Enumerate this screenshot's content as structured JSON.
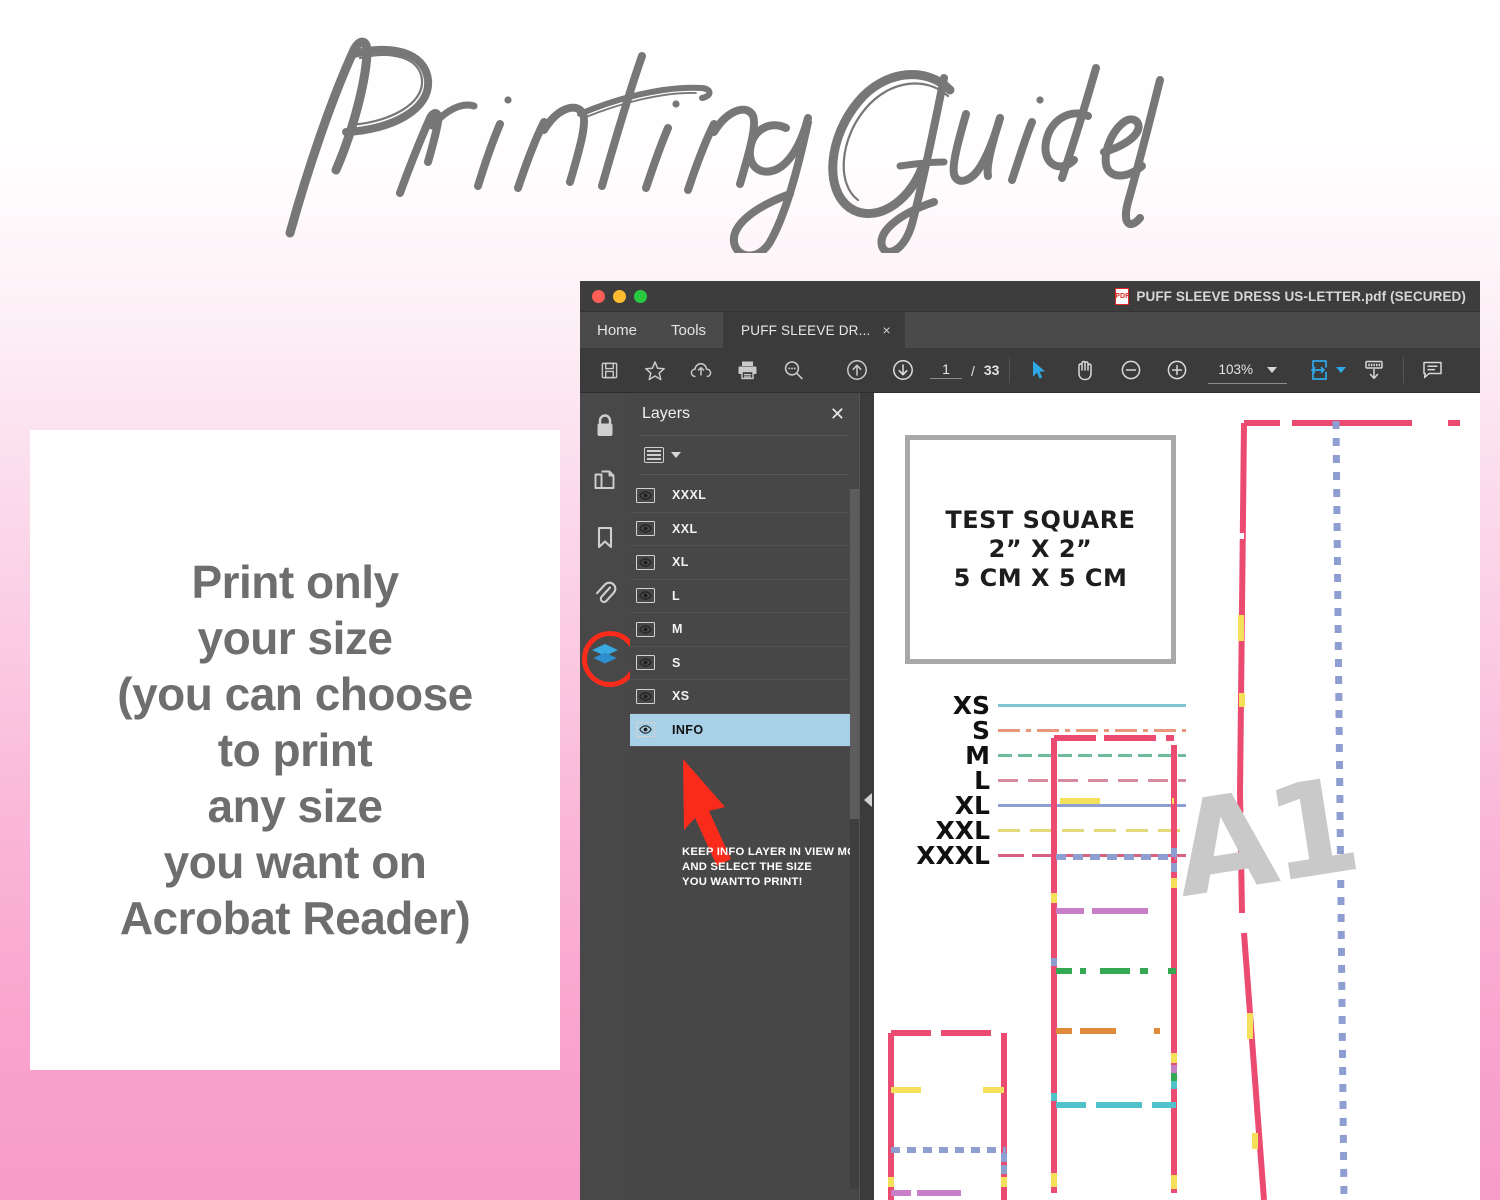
{
  "header": {
    "title": "Printing Guide"
  },
  "info_card": {
    "lines": [
      "Print only",
      "your size",
      "(you can choose",
      "to print",
      "any size",
      "you want on",
      "Acrobat Reader)"
    ]
  },
  "window": {
    "titlebar": {
      "document_title": "PUFF SLEEVE DRESS US-LETTER.pdf (SECURED)",
      "pdf_icon": "pdf-file-icon",
      "traffic_lights": [
        "close-red",
        "minimize-yellow",
        "maximize-green"
      ]
    },
    "tabs": {
      "menu": [
        "Home",
        "Tools"
      ],
      "document_tab": "PUFF SLEEVE DR...",
      "close_label": "×"
    },
    "toolbar": {
      "icons_left": [
        "save-icon",
        "star-icon",
        "upload-cloud-icon",
        "print-icon",
        "search-zoom-icon"
      ],
      "page_nav": [
        "previous-page-icon",
        "next-page-icon"
      ],
      "page_current": "1",
      "page_separator": "/",
      "page_total": "33",
      "tools": [
        "select-cursor-icon",
        "hand-tool-icon",
        "zoom-out-icon",
        "zoom-in-icon"
      ],
      "zoom_level": "103%",
      "icons_right": [
        "fit-page-icon",
        "fit-width-icon",
        "comment-icon"
      ]
    },
    "navrail": [
      {
        "name": "security-lock-icon"
      },
      {
        "name": "page-thumbnails-icon"
      },
      {
        "name": "bookmarks-icon"
      },
      {
        "name": "attachments-icon"
      },
      {
        "name": "layers-icon",
        "selected": true,
        "highlight_color": "#fb2b1c"
      }
    ],
    "layers_panel": {
      "title": "Layers",
      "close_label": "✕",
      "options_icon": "list-options-icon",
      "layers": [
        {
          "label": "XXXL",
          "selected": false
        },
        {
          "label": "XXL",
          "selected": false
        },
        {
          "label": "XL",
          "selected": false
        },
        {
          "label": "L",
          "selected": false
        },
        {
          "label": "M",
          "selected": false
        },
        {
          "label": "S",
          "selected": false
        },
        {
          "label": "XS",
          "selected": false
        },
        {
          "label": "INFO",
          "selected": true
        }
      ],
      "selected_color": "#a8d0e6",
      "annotation": "KEEP INFO LAYER IN VIEW MODE\nAND SELECT THE SIZE\nYOU WANTTO PRINT!",
      "annotation_lines": [
        "KEEP INFO LAYER IN VIEW MODE",
        "AND SELECT THE SIZE",
        "YOU WANTTO PRINT!"
      ],
      "arrow_color": "#fb2b1c"
    },
    "page_content": {
      "test_square": {
        "lines": [
          "TEST SQUARE",
          "2” X 2”",
          "5 CM X 5 CM"
        ],
        "border_color": "#a8a8a8"
      },
      "size_legend": [
        {
          "label": "XS",
          "color": "#7fc4d0",
          "style": "solid"
        },
        {
          "label": "S",
          "color": "#e8977a",
          "style": "dashdot"
        },
        {
          "label": "M",
          "color": "#6fba9a",
          "style": "dashed"
        },
        {
          "label": "L",
          "color": "#d78a9e",
          "style": "dashed"
        },
        {
          "label": "XL",
          "color": "#8e9ed0",
          "style": "solid"
        },
        {
          "label": "XXL",
          "color": "#e3d97a",
          "style": "dashed"
        },
        {
          "label": "XXXL",
          "color": "#d9607f",
          "style": "dashed"
        }
      ],
      "piece_label": "A1",
      "piece_label_color": "#c9c9c9",
      "pattern_colors": {
        "outline": "#ec4b71",
        "yellow": "#f5e05c",
        "blue": "#8e9ed0",
        "purple": "#c87fc8",
        "green": "#35a853",
        "orange": "#e08a3c",
        "teal": "#4fc3c9"
      }
    }
  }
}
